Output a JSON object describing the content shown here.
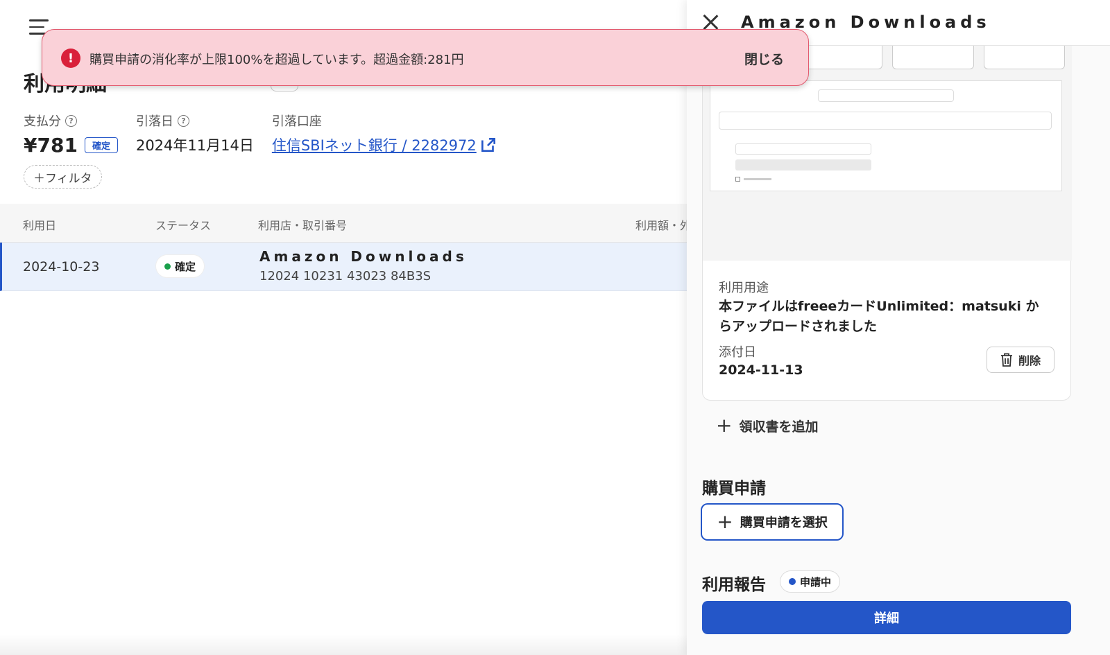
{
  "header": {
    "menu_icon": "hamburger-menu-icon",
    "page_title": "利用明細"
  },
  "summary": {
    "payment_label": "支払分",
    "payment_amount": "¥781",
    "payment_badge": "確定",
    "withdrawal_date_label": "引落日",
    "withdrawal_date": "2024年11月14日",
    "account_label": "引落口座",
    "account_link": "住信SBIネット銀行 / 2282972"
  },
  "filter": {
    "label": "＋フィルタ"
  },
  "table": {
    "columns": [
      "利用日",
      "ステータス",
      "利用店・取引番号",
      "利用額・外"
    ],
    "rows": [
      {
        "date": "2024-10-23",
        "status": "確定",
        "merchant": "Amazon Downloads",
        "transaction_no": "12024 10231 43023 84B3S"
      }
    ]
  },
  "toast": {
    "message": "購買申請の消化率が上限100%を超過しています。超過金額:281円",
    "close_label": "閉じる",
    "status_color": "#d9203a"
  },
  "drawer": {
    "title": "Amazon Downloads",
    "receipt": {
      "usage_label": "利用用途",
      "usage_value": "本ファイルはfreeeカードUnlimited：matsuki からアップロードされました",
      "attached_date_label": "添付日",
      "attached_date": "2024-11-13",
      "delete_label": "削除"
    },
    "add_receipt_label": "領収書を追加",
    "purchase_request_title": "購買申請",
    "select_purchase_request_label": "購買申請を選択",
    "usage_report_title": "利用報告",
    "usage_report_status": "申請中",
    "detail_button_label": "詳細"
  },
  "colors": {
    "accent": "#2456c8",
    "confirmed_dot": "#19a04b",
    "toast_bg": "#fad1d8"
  }
}
